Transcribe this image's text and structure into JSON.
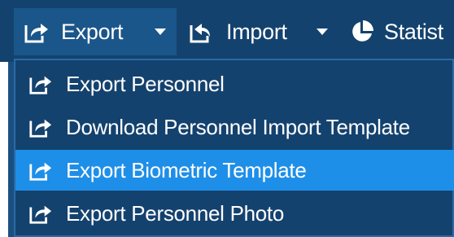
{
  "toolbar": {
    "export_label": "Export",
    "import_label": "Import",
    "statistics_label": "Statist"
  },
  "menu": {
    "items": [
      {
        "label": "Export Personnel",
        "icon": "export-arrow-icon",
        "active": false
      },
      {
        "label": "Download Personnel Import Template",
        "icon": "export-arrow-icon",
        "active": false
      },
      {
        "label": "Export Biometric Template",
        "icon": "export-arrow-icon",
        "active": true
      },
      {
        "label": "Export Personnel Photo",
        "icon": "export-arrow-icon",
        "active": false
      }
    ]
  },
  "colors": {
    "toolbar_bg": "#14426e",
    "active_button_bg": "#1b568a",
    "menu_bg": "#14426e",
    "menu_highlight": "#1e8fe8",
    "text": "#ffffff"
  }
}
